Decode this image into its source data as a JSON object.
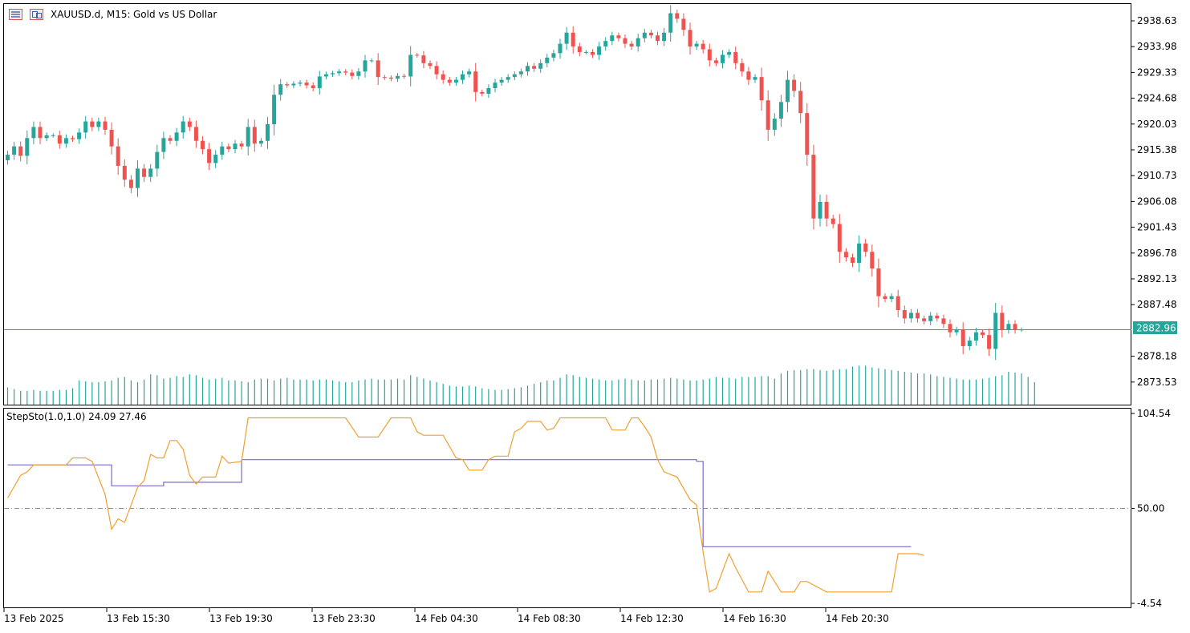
{
  "header": {
    "symbol": "XAUUSD.d, M15:",
    "description": "Gold vs US Dollar"
  },
  "colors": {
    "bull": "#26a69a",
    "bear": "#ef5350",
    "volume": "#26a69a",
    "price_line": "#26a69a",
    "step_line": "#7b68d0",
    "sto_line": "#f0a030",
    "level_line": "#909090",
    "frame": "#000000"
  },
  "icons": [
    "chart-window-icon",
    "chart-restore-icon"
  ],
  "indicator": {
    "label": "StepSto(1.0,1.0) 24.09 27.46",
    "level_label": "50.00"
  },
  "current_price_label": "2882.96",
  "chart_data": [
    {
      "type": "candlestick",
      "title": "XAUUSD.d, M15:  Gold vs US Dollar",
      "ylim": [
        2869.5,
        2942.0
      ],
      "y_tick_labels": [
        "2938.63",
        "2933.98",
        "2929.33",
        "2924.68",
        "2920.03",
        "2915.38",
        "2910.73",
        "2906.08",
        "2901.43",
        "2896.78",
        "2892.13",
        "2887.48",
        "2878.18",
        "2873.53"
      ],
      "current_price": 2882.96,
      "close": [
        2914.5,
        2916,
        2914.3,
        2917.5,
        2919.5,
        2917.5,
        2918,
        2918,
        2916.5,
        2917.5,
        2917.3,
        2918.5,
        2920.5,
        2919.5,
        2920.5,
        2919,
        2916,
        2912.5,
        2910,
        2908.5,
        2912,
        2910.5,
        2912,
        2915,
        2917.5,
        2917,
        2918.5,
        2920.5,
        2919.5,
        2917,
        2915.5,
        2913,
        2914.5,
        2916,
        2915.5,
        2916.5,
        2916,
        2919.5,
        2916.5,
        2917,
        2920,
        2925.3,
        2927.2,
        2927,
        2927.3,
        2927.5,
        2927,
        2926.5,
        2928.6,
        2929,
        2929.2,
        2929.5,
        2929.3,
        2928.7,
        2929.5,
        2931.5,
        2931.5,
        2928.5,
        2928.4,
        2928.2,
        2928.7,
        2928.6,
        2932.5,
        2932.4,
        2931,
        2930.5,
        2929,
        2928,
        2927.5,
        2928,
        2929,
        2929.5,
        2925.8,
        2925.5,
        2926.5,
        2927.5,
        2928,
        2928.5,
        2929,
        2929.5,
        2930.5,
        2930,
        2931,
        2932,
        2932.8,
        2934.5,
        2936.5,
        2934,
        2933,
        2933,
        2932.5,
        2934,
        2935,
        2936,
        2935.5,
        2934.5,
        2934,
        2935.5,
        2936.5,
        2936,
        2935,
        2936.5,
        2940,
        2939,
        2937,
        2934,
        2934.5,
        2933.5,
        2931.5,
        2931,
        2932.5,
        2933,
        2931,
        2929.5,
        2928,
        2928.5,
        2924.3,
        2919,
        2921,
        2924,
        2928,
        2926,
        2922,
        2914.5,
        2903,
        2906,
        2903,
        2902,
        2897,
        2896,
        2895,
        2898.5,
        2897,
        2894,
        2889,
        2888.5,
        2889,
        2886.5,
        2885,
        2886,
        2885,
        2884.5,
        2885.5,
        2885,
        2884,
        2882.5,
        2883,
        2880,
        2881,
        2882.5,
        2882,
        2879.5,
        2886,
        2883,
        2884,
        2883,
        2883
      ]
    },
    {
      "type": "bar",
      "name": "volume",
      "values": [
        20,
        18,
        16,
        16,
        17,
        16,
        16,
        16,
        17,
        17,
        19,
        28,
        27,
        26,
        26,
        27,
        28,
        31,
        32,
        28,
        26,
        29,
        35,
        34,
        30,
        31,
        33,
        32,
        35,
        34,
        31,
        29,
        30,
        31,
        28,
        28,
        27,
        26,
        29,
        30,
        30,
        28,
        30,
        31,
        29,
        29,
        29,
        28,
        29,
        29,
        28,
        27,
        26,
        26,
        28,
        29,
        30,
        29,
        29,
        29,
        30,
        29,
        34,
        32,
        30,
        28,
        26,
        24,
        22,
        21,
        21,
        22,
        21,
        19,
        18,
        17,
        17,
        18,
        19,
        20,
        22,
        24,
        26,
        28,
        28,
        31,
        35,
        34,
        32,
        31,
        30,
        29,
        28,
        28,
        29,
        30,
        29,
        28,
        28,
        29,
        29,
        30,
        31,
        30,
        29,
        28,
        28,
        29,
        30,
        32,
        31,
        31,
        30,
        32,
        32,
        32,
        33,
        33,
        30,
        36,
        39,
        40,
        40,
        41,
        41,
        40,
        39,
        40,
        41,
        41,
        44,
        45,
        45,
        43,
        42,
        41,
        40,
        39,
        38,
        37,
        36,
        36,
        35,
        33,
        32,
        31,
        30,
        29,
        29,
        29,
        30,
        31,
        33,
        34,
        38,
        37,
        36,
        32,
        26
      ]
    },
    {
      "type": "line",
      "title": "StepSto(1.0,1.0) 24.09 27.46",
      "ylim": [
        -4.54,
        104.54
      ],
      "y_tick_labels": [
        "104.54",
        "50.00",
        "-4.54"
      ],
      "level": 50.0,
      "x_tick_labels": [
        "13 Feb 2025",
        "13 Feb 15:30",
        "13 Feb 19:30",
        "13 Feb 23:30",
        "14 Feb 04:30",
        "14 Feb 08:30",
        "14 Feb 12:30",
        "14 Feb 16:30",
        "14 Feb 20:30"
      ],
      "series": [
        {
          "role": "step",
          "values": [
            [
              0,
              75
            ],
            [
              16,
              75
            ],
            [
              16,
              63
            ],
            [
              24,
              63
            ],
            [
              24,
              65
            ],
            [
              36,
              65
            ],
            [
              36,
              78
            ],
            [
              106,
              78
            ],
            [
              106,
              77
            ],
            [
              107,
              77
            ],
            [
              107,
              28
            ],
            [
              139,
              28
            ]
          ]
        },
        {
          "role": "sto",
          "values": [
            [
              0,
              56
            ],
            [
              2,
              69
            ],
            [
              3,
              71
            ],
            [
              4,
              75
            ],
            [
              9,
              75
            ],
            [
              10,
              79
            ],
            [
              12,
              79
            ],
            [
              13,
              77
            ],
            [
              15,
              58
            ],
            [
              16,
              38
            ],
            [
              17,
              44
            ],
            [
              18,
              42
            ],
            [
              20,
              62
            ],
            [
              21,
              66
            ],
            [
              22,
              81
            ],
            [
              23,
              79
            ],
            [
              24,
              79
            ],
            [
              25,
              89
            ],
            [
              26,
              89
            ],
            [
              27,
              84
            ],
            [
              28,
              69
            ],
            [
              29,
              64
            ],
            [
              30,
              68
            ],
            [
              32,
              68
            ],
            [
              33,
              80
            ],
            [
              34,
              76
            ],
            [
              36,
              77
            ],
            [
              37,
              102
            ],
            [
              52,
              102
            ],
            [
              54,
              91
            ],
            [
              57,
              91
            ],
            [
              59,
              102
            ],
            [
              62,
              102
            ],
            [
              63,
              94
            ],
            [
              64,
              92
            ],
            [
              67,
              92
            ],
            [
              69,
              79
            ],
            [
              70,
              78
            ],
            [
              71,
              72
            ],
            [
              73,
              72
            ],
            [
              74,
              78
            ],
            [
              75,
              80
            ],
            [
              77,
              80
            ],
            [
              78,
              94
            ],
            [
              79,
              96
            ],
            [
              80,
              100
            ],
            [
              82,
              100
            ],
            [
              83,
              95
            ],
            [
              84,
              96
            ],
            [
              85,
              102
            ],
            [
              92,
              102
            ],
            [
              93,
              95
            ],
            [
              95,
              95
            ],
            [
              96,
              102
            ],
            [
              97,
              102
            ],
            [
              98,
              97
            ],
            [
              99,
              91
            ],
            [
              100,
              78
            ],
            [
              101,
              71
            ],
            [
              103,
              68
            ],
            [
              105,
              55
            ],
            [
              106,
              52
            ],
            [
              107,
              25
            ],
            [
              108,
              2
            ],
            [
              109,
              4
            ],
            [
              110,
              14
            ],
            [
              111,
              24
            ],
            [
              112,
              16
            ],
            [
              114,
              2
            ],
            [
              116,
              2
            ],
            [
              117,
              14
            ],
            [
              118,
              8
            ],
            [
              119,
              2
            ],
            [
              121,
              2
            ],
            [
              122,
              8
            ],
            [
              123,
              8
            ],
            [
              124,
              6
            ],
            [
              126,
              2
            ],
            [
              136,
              2
            ],
            [
              137,
              24
            ],
            [
              140,
              24
            ],
            [
              141,
              23
            ]
          ]
        }
      ]
    }
  ]
}
